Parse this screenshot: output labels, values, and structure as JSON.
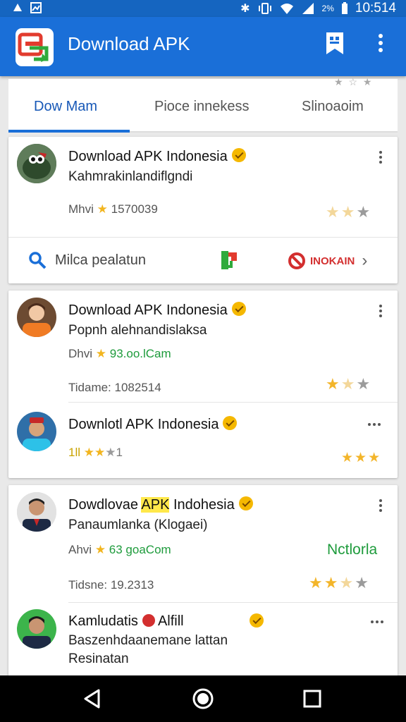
{
  "status_bar": {
    "time": "10:514",
    "battery_pct": "2%"
  },
  "app_bar": {
    "title": "Download APK",
    "icons": [
      "app-logo-icon",
      "bookmark-icon",
      "more-vert-icon"
    ]
  },
  "tabs": [
    {
      "label": "Dow Mam",
      "active": true
    },
    {
      "label": "Pioce innekess",
      "active": false
    },
    {
      "label": "Slinoaoim",
      "active": false
    }
  ],
  "card1": {
    "title": "Download APK Indonesia",
    "subtitle": "Kahmrakinlandiflgndi",
    "meta_prefix": "Mhvi",
    "meta_value": "1570039",
    "rating": {
      "filled": 2,
      "total": 3
    },
    "actions": {
      "search_label": "Milca pealatun",
      "reject_label": "INOKAIN"
    }
  },
  "card2": {
    "row1": {
      "title": "Download APK Indonesia",
      "subtitle": "Popnh alehnandislaksa",
      "meta_prefix": "Dhvi",
      "meta_value": "93.oo.lCam",
      "date_line": "Tidame: 1082514",
      "rating": {
        "filled": 2,
        "total": 3
      }
    },
    "row2": {
      "title": "Downlotl APK Indonesia",
      "rating_text": "1ll",
      "rating_suffix": "1",
      "stars": {
        "filled": 3,
        "total": 3
      }
    }
  },
  "card3": {
    "row1": {
      "title_pre": "Dowdlovae",
      "title_hl": "APK",
      "title_post": "Indohesia",
      "subtitle": "Panaumlanka (Klogaei)",
      "meta_prefix": "Ahvi",
      "meta_value": "63 goaCom",
      "action_label": "Nctlorla",
      "date_line": "Tidsne: 19.2313",
      "rating": {
        "filled": 2,
        "total": 3
      }
    },
    "row2": {
      "title": "Kamludatis",
      "title_suffix": "Alfill",
      "subtitle_line1": "Baszenhdaanemane lattan",
      "subtitle_line2": "Resinatan"
    }
  },
  "nav": {
    "icons": [
      "back-icon",
      "home-icon",
      "recents-icon"
    ]
  }
}
